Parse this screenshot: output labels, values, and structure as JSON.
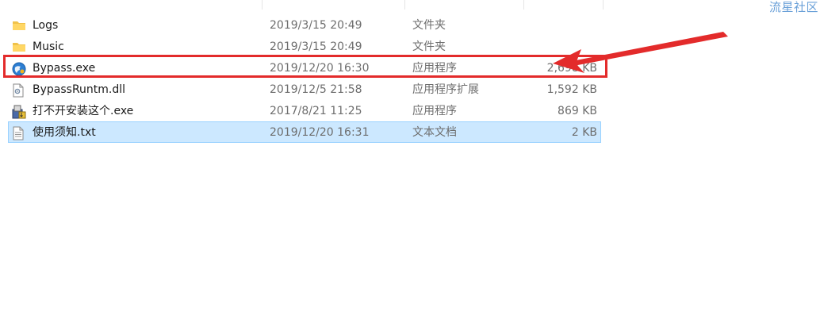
{
  "watermark": "流星社区",
  "files": [
    {
      "name": "Logs",
      "date": "2019/3/15 20:49",
      "type": "文件夹",
      "size": "",
      "icon": "folder-icon",
      "selected": false
    },
    {
      "name": "Music",
      "date": "2019/3/15 20:49",
      "type": "文件夹",
      "size": "",
      "icon": "folder-icon",
      "selected": false
    },
    {
      "name": "Bypass.exe",
      "date": "2019/12/20 16:30",
      "type": "应用程序",
      "size": "2,698 KB",
      "icon": "app-globe-icon",
      "selected": false
    },
    {
      "name": "BypassRuntm.dll",
      "date": "2019/12/5 21:58",
      "type": "应用程序扩展",
      "size": "1,592 KB",
      "icon": "dll-file-icon",
      "selected": false
    },
    {
      "name": "打不开安装这个.exe",
      "date": "2017/8/21 11:25",
      "type": "应用程序",
      "size": "869 KB",
      "icon": "installer-icon",
      "selected": false
    },
    {
      "name": "使用须知.txt",
      "date": "2019/12/20 16:31",
      "type": "文本文档",
      "size": "2 KB",
      "icon": "text-file-icon",
      "selected": true
    }
  ],
  "colors": {
    "annotation_red": "#e32b2b",
    "selection_bg": "#cce8ff",
    "selection_border": "#99d1ff",
    "folder_yellow": "#f0c24a"
  }
}
